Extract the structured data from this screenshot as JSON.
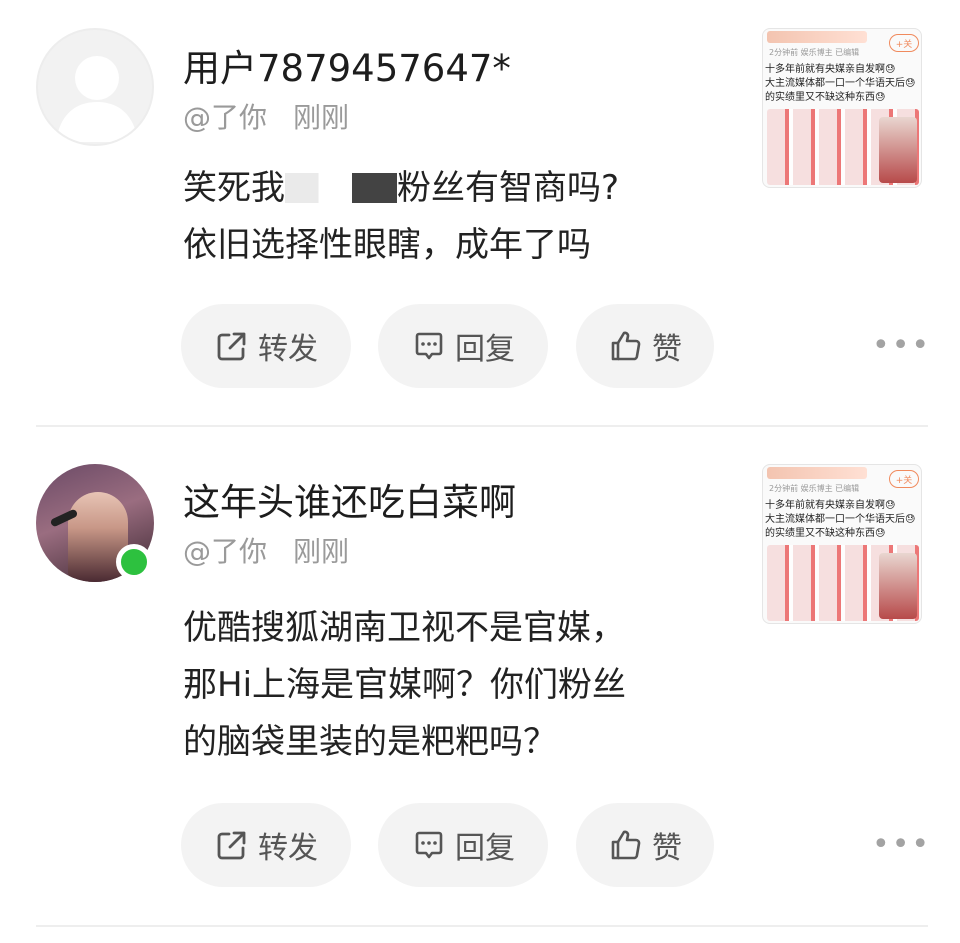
{
  "comments": [
    {
      "username": "用户7879457647*",
      "handle": "@了你",
      "time": "刚刚",
      "text_line1_before": "笑死我",
      "text_line1_after": "粉丝有智商吗?",
      "text_line2": "依旧选择性眼瞎，成年了吗",
      "actions": {
        "repost": "转发",
        "reply": "回复",
        "like": "赞"
      },
      "more": "•••",
      "thumbnail": {
        "follow": "+关",
        "meta": "2分钟前  娱乐博主  已编辑",
        "lines": [
          "十多年前就有央媒亲自发啊😓",
          "大主流媒体都一口一个华语天后😓",
          "的实绩里又不缺这种东西😓"
        ]
      }
    },
    {
      "username": "这年头谁还吃白菜啊",
      "handle": "@了你",
      "time": "刚刚",
      "text_lines": [
        "优酷搜狐湖南卫视不是官媒，",
        "那Hi上海是官媒啊？你们粉丝",
        "的脑袋里装的是粑粑吗？"
      ],
      "actions": {
        "repost": "转发",
        "reply": "回复",
        "like": "赞"
      },
      "more": "•••",
      "online": true,
      "thumbnail": {
        "follow": "+关",
        "meta": "2分钟前  娱乐博主  已编辑",
        "lines": [
          "十多年前就有央媒亲自发啊😓",
          "大主流媒体都一口一个华语天后😓",
          "的实绩里又不缺这种东西😓"
        ]
      }
    }
  ],
  "colors": {
    "online_dot": "#2dc13f",
    "button_bg": "#f3f3f3",
    "meta_text": "#9a9a9a"
  },
  "icons": [
    "repost-icon",
    "comment-icon",
    "thumbs-up-icon",
    "more-icon"
  ]
}
